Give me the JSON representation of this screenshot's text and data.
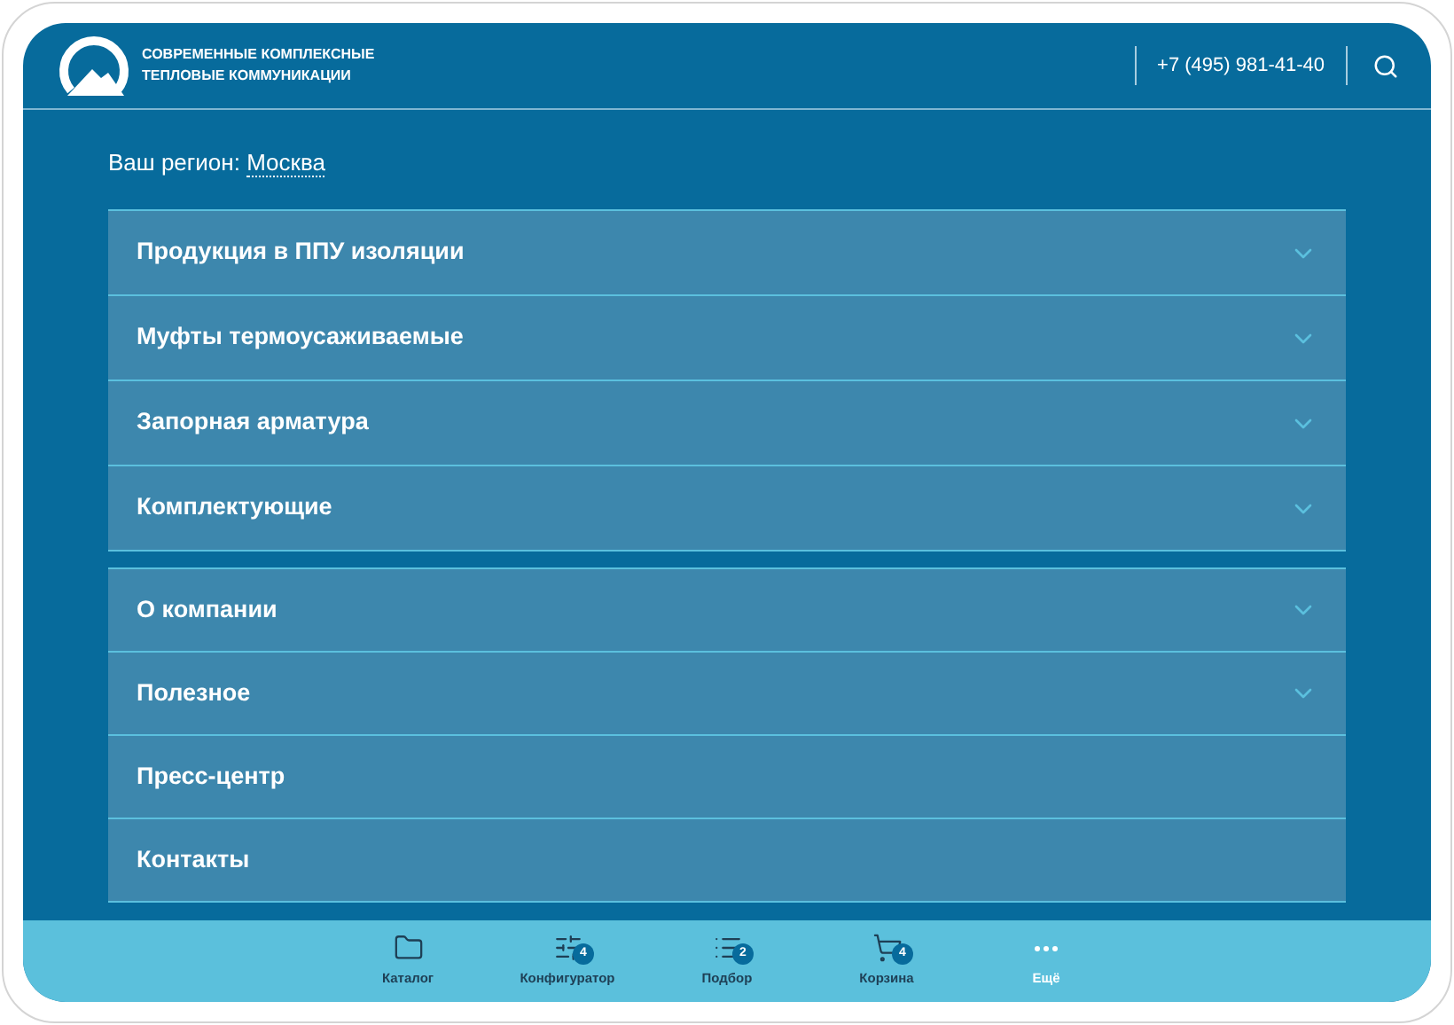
{
  "header": {
    "company_name": [
      "СОВРЕМЕННЫЕ КОМПЛЕКСНЫЕ",
      "ТЕПЛОВЫЕ КОММУНИКАЦИИ"
    ],
    "phone": "+7 (495) 981-41-40"
  },
  "region": {
    "label": "Ваш регион:",
    "value": "Москва"
  },
  "menu_groups": [
    {
      "items": [
        {
          "label": "Продукция в ППУ изоляции",
          "expandable": true
        },
        {
          "label": "Муфты термоусаживаемые",
          "expandable": true
        },
        {
          "label": "Запорная арматура",
          "expandable": true
        },
        {
          "label": "Комплектующие",
          "expandable": true
        }
      ]
    },
    {
      "items": [
        {
          "label": "О компании",
          "expandable": true
        },
        {
          "label": "Полезное",
          "expandable": true
        },
        {
          "label": "Пресс-центр",
          "expandable": false
        },
        {
          "label": "Контакты",
          "expandable": false
        }
      ]
    }
  ],
  "bottom_nav": [
    {
      "kind": "folder",
      "label": "Каталог",
      "selected": false
    },
    {
      "kind": "sliders",
      "label": "Конфигуратор",
      "badge": "4",
      "selected": false
    },
    {
      "kind": "list",
      "label": "Подбор",
      "badge": "2",
      "selected": false
    },
    {
      "kind": "cart",
      "label": "Корзина",
      "badge": "4",
      "selected": false
    },
    {
      "kind": "more",
      "label": "Ещё",
      "selected": true
    }
  ]
}
